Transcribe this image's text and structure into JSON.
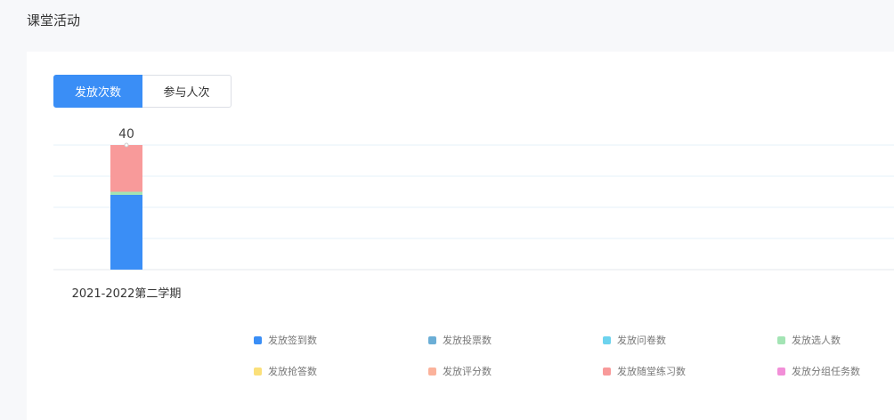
{
  "page": {
    "title": "课堂活动"
  },
  "tabs": [
    {
      "label": "发放次数",
      "active": true
    },
    {
      "label": "参与人次",
      "active": false
    }
  ],
  "chart_data": {
    "type": "bar",
    "stacked": true,
    "categories": [
      "2021-2022第二学期"
    ],
    "totals": [
      "40"
    ],
    "ylim": [
      0,
      40
    ],
    "grid": true,
    "legend_position": "bottom",
    "series": [
      {
        "name": "发放签到数",
        "values": [
          24
        ],
        "color": "#3a8ef6"
      },
      {
        "name": "发放投票数",
        "values": [
          0
        ],
        "color": "#6baed6"
      },
      {
        "name": "发放问卷数",
        "values": [
          0
        ],
        "color": "#6dd3ee"
      },
      {
        "name": "发放选人数",
        "values": [
          1
        ],
        "color": "#a3e4b4"
      },
      {
        "name": "发放抢答数",
        "values": [
          0
        ],
        "color": "#fbe07a"
      },
      {
        "name": "发放评分数",
        "values": [
          0
        ],
        "color": "#fbb29b"
      },
      {
        "name": "发放随堂练习数",
        "values": [
          15
        ],
        "color": "#f89a9a"
      },
      {
        "name": "发放分组任务数",
        "values": [
          0
        ],
        "color": "#f28fd8"
      }
    ]
  }
}
